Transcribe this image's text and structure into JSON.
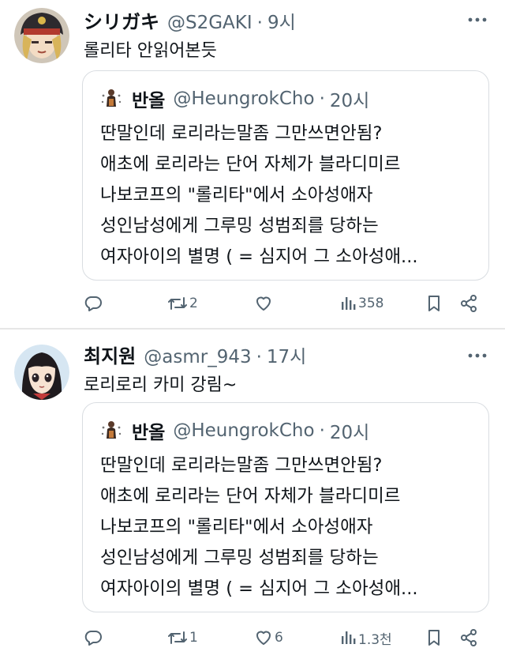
{
  "tweets": [
    {
      "author": {
        "name": "シリガキ",
        "handle": "@S2GAKI",
        "time": "9시"
      },
      "text": "롤리타 안읽어본듯",
      "quote": {
        "author": {
          "name": "반올",
          "handle": "@HeungrokCho",
          "time": "20시"
        },
        "lines": [
          "딴말인데 로리라는말좀 그만쓰면안됨?",
          "애초에 로리라는 단어 자체가 블라디미르",
          "나보코프의 \"롤리타\"에서 소아성애자",
          "성인남성에게 그루밍 성범죄를 당하는",
          "여자아이의 별명 ( = 심지어 그 소아성애..."
        ]
      },
      "stats": {
        "replies": "",
        "retweets": "2",
        "likes": "",
        "views": "358"
      }
    },
    {
      "author": {
        "name": "최지원",
        "handle": "@asmr_943",
        "time": "17시"
      },
      "text": "로리로리 카미 강림~",
      "quote": {
        "author": {
          "name": "반올",
          "handle": "@HeungrokCho",
          "time": "20시"
        },
        "lines": [
          "딴말인데 로리라는말좀 그만쓰면안됨?",
          "애초에 로리라는 단어 자체가 블라디미르",
          "나보코프의 \"롤리타\"에서 소아성애자",
          "성인남성에게 그루밍 성범죄를 당하는",
          "여자아이의 별명 ( = 심지어 그 소아성애..."
        ]
      },
      "stats": {
        "replies": "",
        "retweets": "1",
        "likes": "6",
        "views": "1.3천"
      }
    }
  ],
  "separator": "·",
  "icons": [
    "more-icon",
    "reply-icon",
    "retweet-icon",
    "like-icon",
    "views-icon",
    "bookmark-icon",
    "share-icon"
  ],
  "colors": {
    "text": "#0f1419",
    "secondary": "#536471",
    "border": "#d9dde1",
    "divider": "#e6e6e6"
  }
}
